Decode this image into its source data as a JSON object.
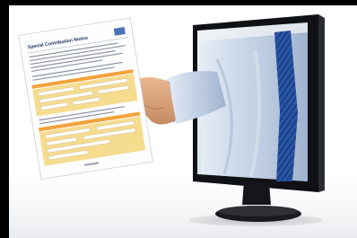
{
  "scene": {
    "subject": "hand-reaching-out-of-monitor-with-form",
    "colors": {
      "background": "#000000",
      "photo_background": "#ffffff",
      "monitor_bezel": "#101114",
      "screen_backdrop": "#d9e2ea",
      "shirt": "#c5d3e6",
      "tie": "#2a58a8",
      "form_highlight": "#f5dc8f",
      "form_orange_band": "#f2a23a"
    }
  },
  "document": {
    "title": "Special Contribution Notice",
    "logo": "logo-mark"
  }
}
